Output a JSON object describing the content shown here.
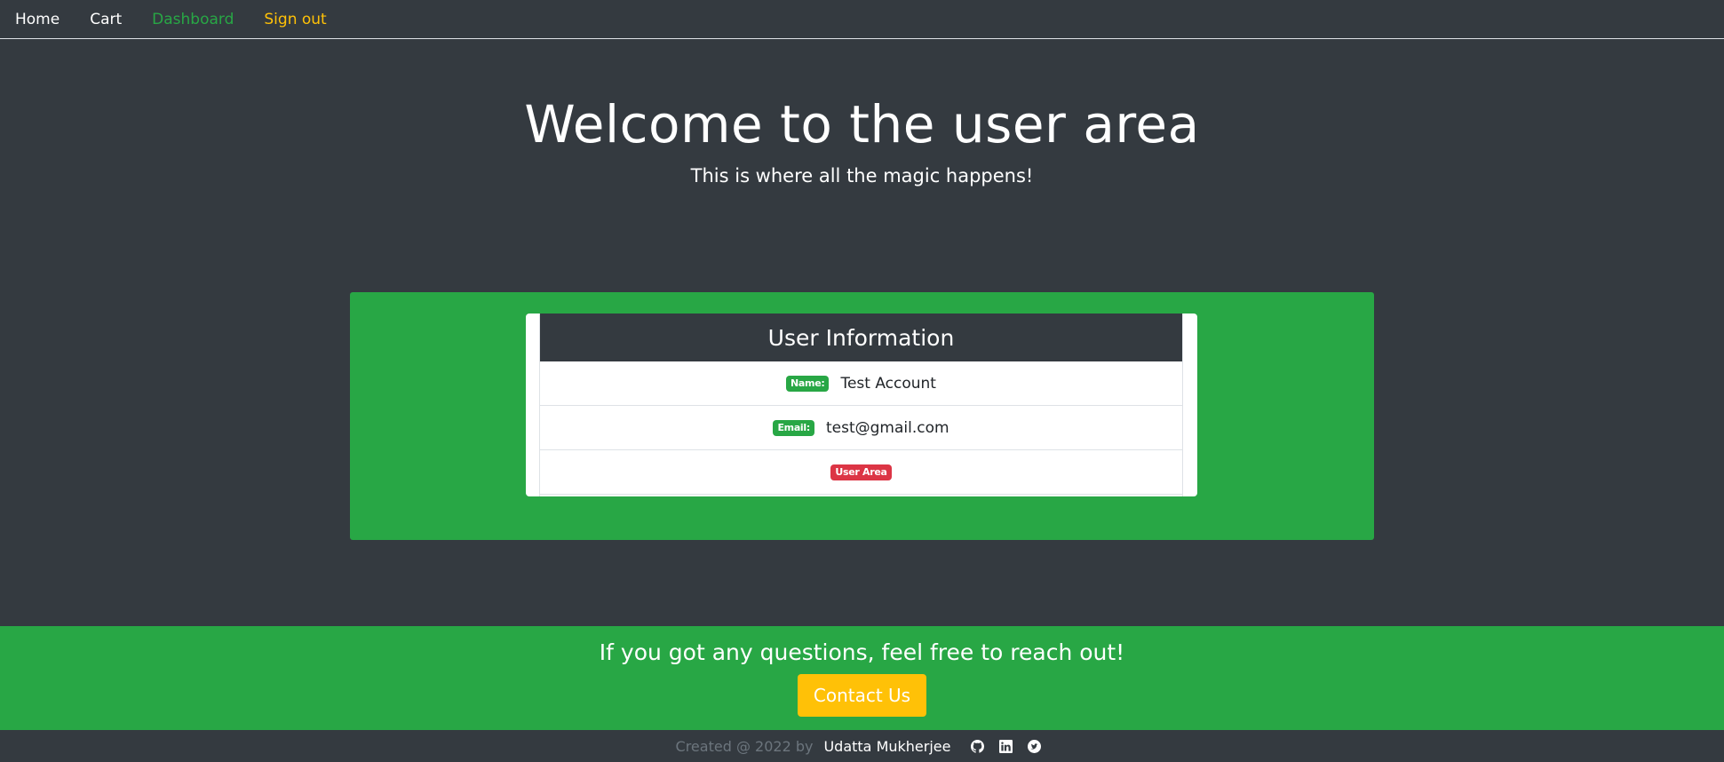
{
  "nav": {
    "items": [
      {
        "label": "Home",
        "color": "#ffffff"
      },
      {
        "label": "Cart",
        "color": "#ffffff"
      },
      {
        "label": "Dashboard",
        "color": "#28a745"
      },
      {
        "label": "Sign out",
        "color": "#ffc107"
      }
    ]
  },
  "hero": {
    "title": "Welcome to the user area",
    "subtitle": "This is where all the magic happens!"
  },
  "user_card": {
    "header": "User Information",
    "name_badge": "Name:",
    "name_value": "Test Account",
    "email_badge": "Email:",
    "email_value": "test@gmail.com",
    "area_badge": "User Area"
  },
  "contact": {
    "text": "If you got any questions, feel free to reach out!",
    "button_label": "Contact Us"
  },
  "footer": {
    "prefix": "Created @ 2022 by",
    "author": "Udatta Mukherjee",
    "icons": [
      "github-icon",
      "linkedin-icon",
      "twitter-icon"
    ]
  },
  "colors": {
    "background": "#343a40",
    "success": "#28a745",
    "warning": "#ffc107",
    "danger": "#dc3545"
  }
}
